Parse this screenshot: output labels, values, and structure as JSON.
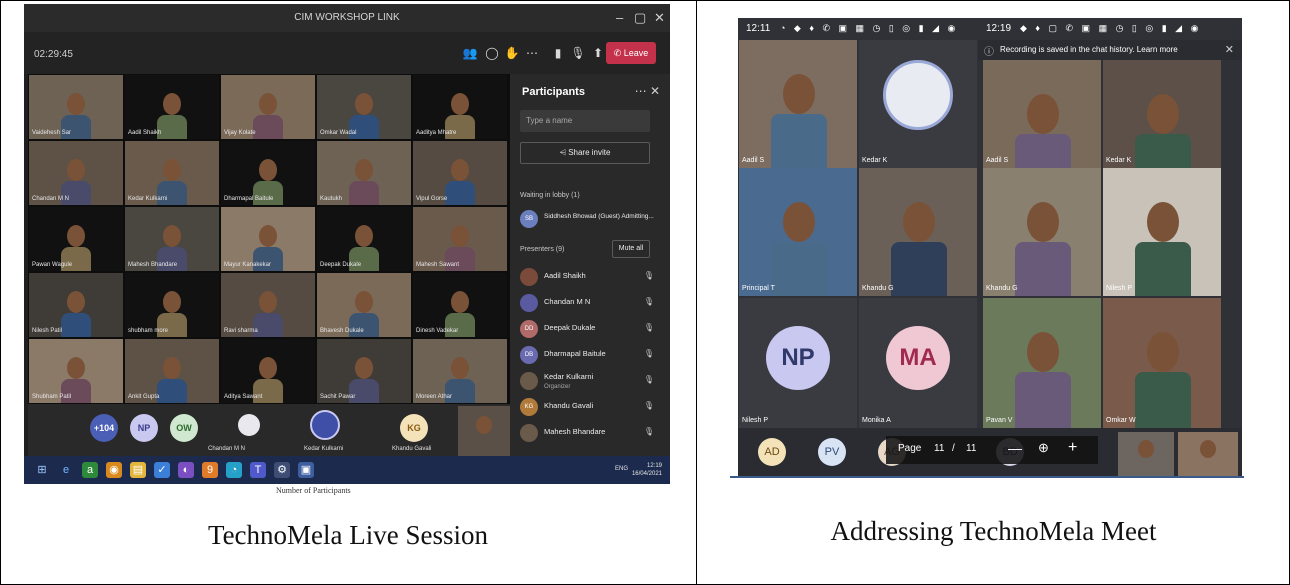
{
  "captions": {
    "left": "TechnoMela Live Session",
    "right": "Addressing TechnoMela Meet"
  },
  "teams": {
    "window_title": "CIM WORKSHOP LINK",
    "timer": "02:29:45",
    "leave_label": "Leave",
    "grid_tiles": [
      "Vaidehesh Sar",
      "Aadil Shaikh",
      "Vijay Kolate",
      "Omkar Wadal",
      "Aaditya Mhatre",
      "Chandan M N",
      "Kedar Kulkarni",
      "Dharmapal Baitule",
      "Kautukh",
      "Vipul Gorse",
      "Pawan Wagule",
      "Mahesh Bhandare",
      "Mayur Kanakekar",
      "Deepak Dukale",
      "Mahesh Sawant",
      "Nilesh Patil",
      "shubham more",
      "Ravi sharma",
      "Bhavesh Dukale",
      "Dinesh Vadekar",
      "Shubham Patil",
      "Ankit Gupta",
      "Aditya Sawant",
      "Sachit Pawar",
      "Moreen Athar"
    ],
    "strip": {
      "overflow_badge": "+104",
      "avatars": [
        "NP",
        "OW"
      ],
      "named": [
        "Chandan M N",
        "Kedar Kulkarni",
        "Khandu Gavali"
      ],
      "kg_avatar": "KG"
    },
    "participants": {
      "heading": "Participants",
      "search_placeholder": "Type a name",
      "share_label": "Share invite",
      "lobby_header": "Waiting in lobby (1)",
      "lobby_person": "Siddhesh Bhowad (Guest) Admitting...",
      "lobby_initials": "SB",
      "presenters_header": "Presenters (9)",
      "mute_all": "Mute all",
      "list": [
        {
          "initials": "",
          "name": "Aadil Shaikh",
          "role": ""
        },
        {
          "initials": "",
          "name": "Chandan M N",
          "role": ""
        },
        {
          "initials": "DD",
          "name": "Deepak Dukale",
          "role": ""
        },
        {
          "initials": "DB",
          "name": "Dharmapal Baitule",
          "role": ""
        },
        {
          "initials": "",
          "name": "Kedar Kulkarni",
          "role": "Organizer"
        },
        {
          "initials": "KG",
          "name": "Khandu Gavali",
          "role": ""
        },
        {
          "initials": "",
          "name": "Mahesh Bhandare",
          "role": ""
        }
      ]
    },
    "taskbar": {
      "lang": "ENG",
      "time": "12:19",
      "date": "16/04/2021"
    },
    "below_text": "Number of Participants"
  },
  "phones": {
    "left_status_time": "12:11",
    "right_status_time": "12:19",
    "recording_text": "Recording is saved in the chat history. Learn more",
    "tiles": [
      "Aadil S",
      "Kedar K",
      "Aadil S",
      "Kedar K",
      "Principal T",
      "Khandu G",
      "Khandu G",
      "Nilesh P",
      "Nilesh P",
      "Monika A",
      "Pavan V",
      "Omkar W"
    ],
    "big_avatars": [
      "NP",
      "MA"
    ],
    "bottom_avatars": [
      "AD",
      "PV",
      "AG",
      "BD"
    ],
    "pager": {
      "label": "Page",
      "current": "11",
      "sep": "/",
      "total": "11"
    }
  },
  "colors": {
    "teams_leave": "#c4314b",
    "np_avatar": "#c8c8f0",
    "ma_avatar": "#f0c8d4",
    "taskbar": "#1c2b4d"
  }
}
